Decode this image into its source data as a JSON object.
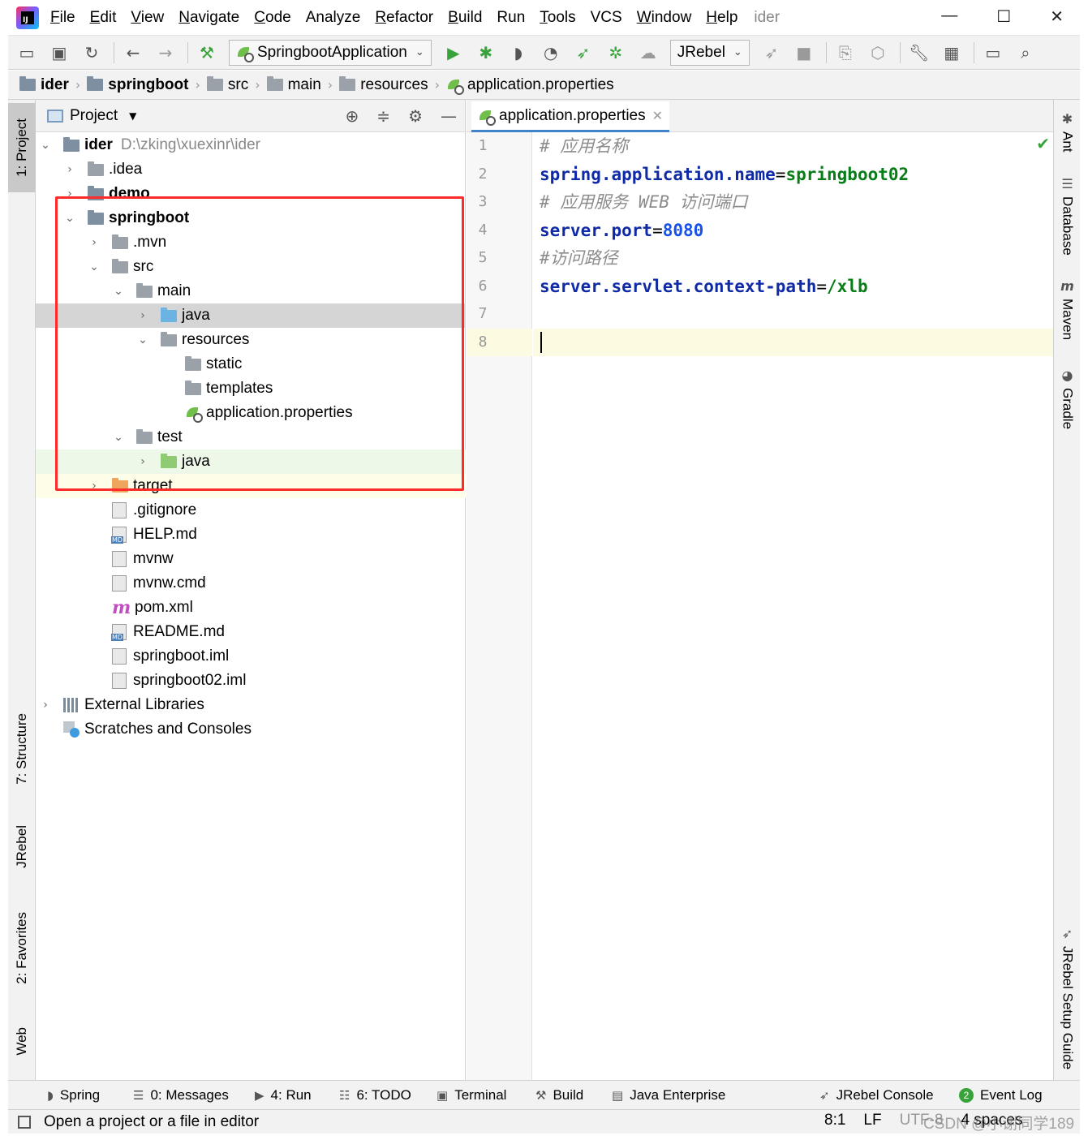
{
  "menubar": {
    "logo_text": "IJ",
    "items": [
      "File",
      "Edit",
      "View",
      "Navigate",
      "Code",
      "Analyze",
      "Refactor",
      "Build",
      "Run",
      "Tools",
      "VCS",
      "Window",
      "Help"
    ],
    "window_title": "ider",
    "controls": {
      "minimize": "—",
      "maximize": "☐",
      "close": "✕"
    }
  },
  "toolbar": {
    "run_config": "SpringbootApplication",
    "jrebel_combo": "JRebel",
    "icons": [
      "open-folder-icon",
      "save-icon",
      "sync-icon",
      "back-arrow-icon",
      "forward-arrow-icon",
      "build-hammer-icon",
      "run-icon",
      "debug-icon",
      "coverage-icon",
      "profile-icon",
      "jrebel-run-icon",
      "jrebel-debug-icon",
      "attach-icon",
      "stop-icon",
      "project-structure-icon",
      "settings-wrench-icon",
      "search-icon"
    ]
  },
  "breadcrumb": {
    "items": [
      {
        "label": "ider",
        "bold": true,
        "icon": "module"
      },
      {
        "label": "springboot",
        "bold": true,
        "icon": "module"
      },
      {
        "label": "src",
        "bold": false,
        "icon": "folder"
      },
      {
        "label": "main",
        "bold": false,
        "icon": "folder"
      },
      {
        "label": "resources",
        "bold": false,
        "icon": "folder"
      },
      {
        "label": "application.properties",
        "bold": false,
        "icon": "spring-leaf"
      }
    ]
  },
  "left_strip": {
    "tabs": [
      "1: Project",
      "7: Structure",
      "JRebel",
      "2: Favorites",
      "Web"
    ]
  },
  "right_strip": {
    "tabs": [
      "Ant",
      "Database",
      "Maven",
      "Gradle",
      "JRebel Setup Guide"
    ]
  },
  "project_panel": {
    "title": "Project",
    "root": {
      "name": "ider",
      "path": "D:\\zking\\xuexinr\\ider"
    },
    "rows": [
      {
        "label": "ider",
        "path": "D:\\zking\\xuexinr\\ider"
      },
      {
        "label": ".idea"
      },
      {
        "label": "demo"
      },
      {
        "label": "springboot"
      },
      {
        "label": ".mvn"
      },
      {
        "label": "src"
      },
      {
        "label": "main"
      },
      {
        "label": "java"
      },
      {
        "label": "resources"
      },
      {
        "label": "static"
      },
      {
        "label": "templates"
      },
      {
        "label": "application.properties"
      },
      {
        "label": "test"
      },
      {
        "label": "java"
      },
      {
        "label": "target"
      },
      {
        "label": ".gitignore"
      },
      {
        "label": "HELP.md"
      },
      {
        "label": "mvnw"
      },
      {
        "label": "mvnw.cmd"
      },
      {
        "label": "pom.xml"
      },
      {
        "label": "README.md"
      },
      {
        "label": "springboot.iml"
      },
      {
        "label": "springboot02.iml"
      },
      {
        "label": "External Libraries"
      },
      {
        "label": "Scratches and Consoles"
      }
    ]
  },
  "editor": {
    "tab_label": "application.properties",
    "line_numbers": [
      "1",
      "2",
      "3",
      "4",
      "5",
      "6",
      "7",
      "8"
    ],
    "lines": {
      "l1": "#  应用名称",
      "l2_key": "spring.application.name",
      "l2_eq": "=",
      "l2_val": "springboot02",
      "l3": "#  应用服务 WEB 访问端口",
      "l4_key": "server.port",
      "l4_eq": "=",
      "l4_val": "8080",
      "l5": "#访问路径",
      "l6_key": "server.servlet.context-path",
      "l6_eq": "=",
      "l6_val": "/xlb"
    },
    "current_line": 8,
    "inspection_status": "✔"
  },
  "bottom_bar": {
    "items": [
      "Spring",
      "0: Messages",
      "4: Run",
      "6: TODO",
      "Terminal",
      "Build",
      "Java Enterprise",
      "JRebel Console",
      "Event Log"
    ],
    "event_log_badge": "2"
  },
  "status_bar": {
    "message": "Open a project or a file in editor",
    "position": "8:1",
    "line_separator": "LF",
    "encoding": "UTF-8",
    "indent": "4 spaces",
    "watermark": "CSDN @小谢同学189"
  },
  "colors": {
    "highlight_box": "#ff2a2a",
    "keyword": "#0f2aa6",
    "value": "#067d17",
    "number": "#1750eb",
    "comment": "#8c8c8c",
    "current_line": "#fcfae1"
  }
}
